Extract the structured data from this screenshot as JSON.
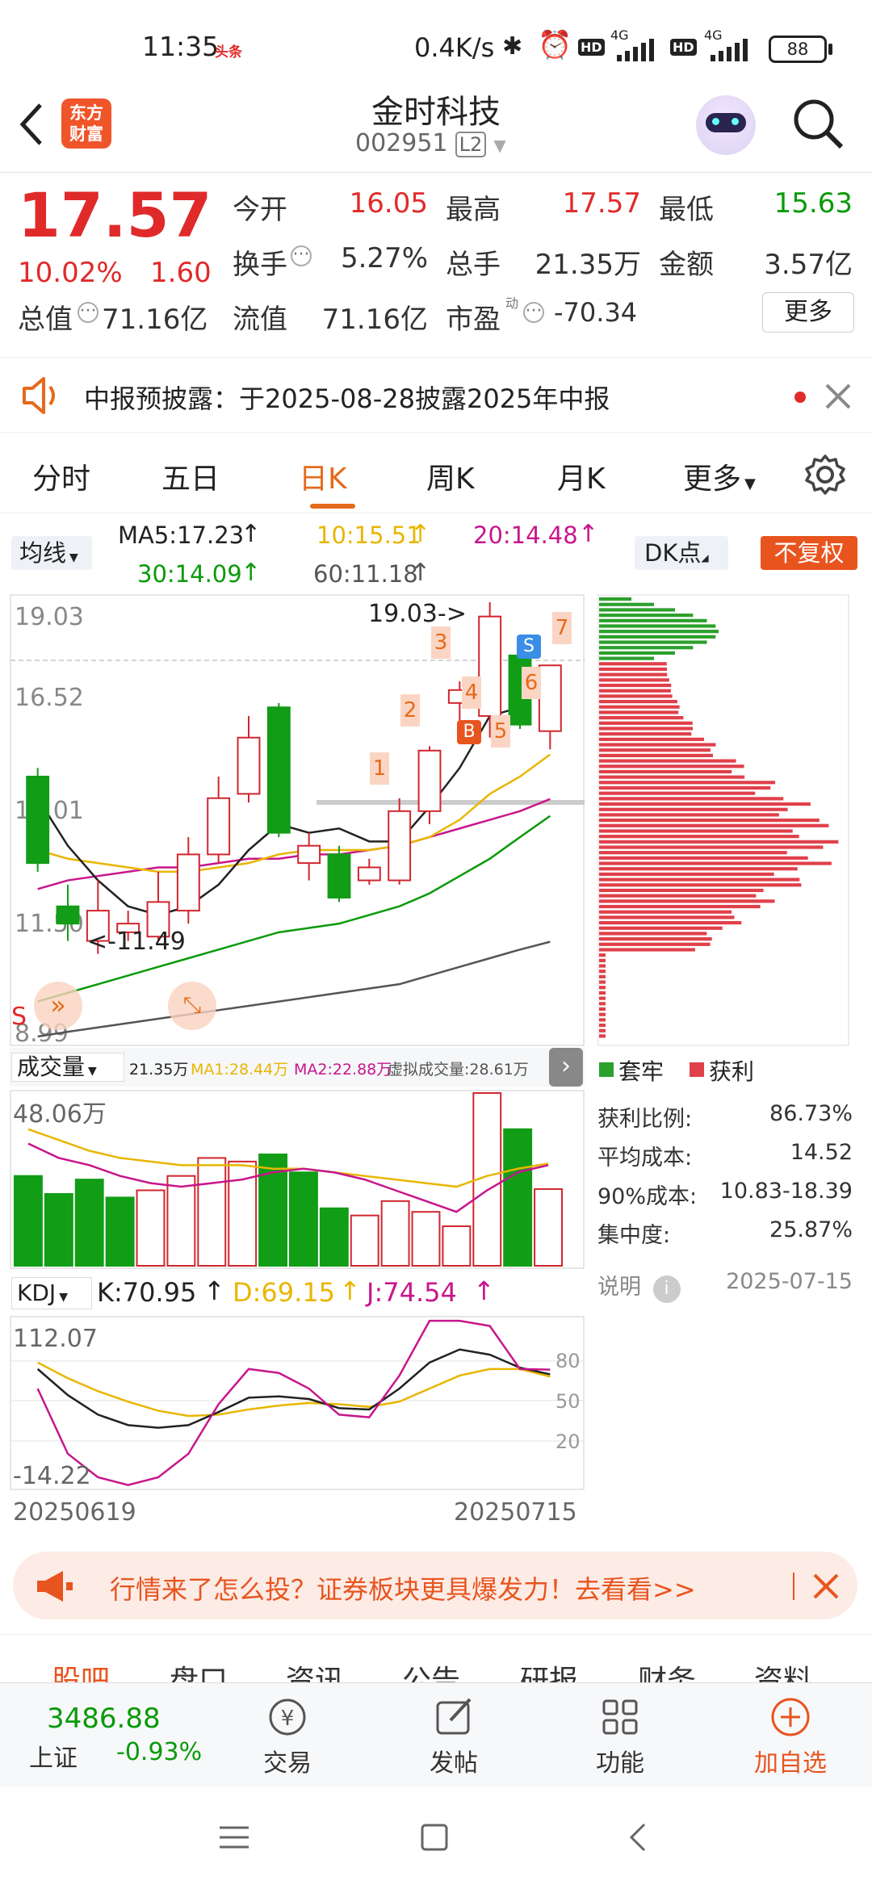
{
  "status_bar": {
    "time": "11:35",
    "news_badge": "头条",
    "speed": "0.4K/s",
    "net1": "4G",
    "net2": "4G",
    "hd": "HD",
    "battery": "88"
  },
  "header": {
    "logo_line1": "东方",
    "logo_line2": "财富",
    "title": "金时科技",
    "code": "002951",
    "level": "L2"
  },
  "quote": {
    "price": "17.57",
    "change_pct": "10.02%",
    "change": "1.60",
    "rows": [
      [
        {
          "label": "今开",
          "value": "16.05",
          "color": "red"
        },
        {
          "label": "最高",
          "value": "17.57",
          "color": "red"
        },
        {
          "label": "最低",
          "value": "15.63",
          "color": "green"
        }
      ],
      [
        {
          "label": "换手",
          "value": "5.27%",
          "color": "dark"
        },
        {
          "label": "总手",
          "value": "21.35万",
          "color": "dark"
        },
        {
          "label": "金额",
          "value": "3.57亿",
          "color": "dark"
        }
      ]
    ],
    "total_cap_label": "总值",
    "total_cap": "71.16亿",
    "float_cap_label": "流值",
    "float_cap": "71.16亿",
    "pe_label": "市盈",
    "pe_sup": "动",
    "pe": "-70.34",
    "more_button": "更多"
  },
  "notice": {
    "text": "中报预披露：于2025-08-28披露2025年中报"
  },
  "tabs": {
    "items": [
      "分时",
      "五日",
      "日K",
      "周K",
      "月K",
      "更多"
    ],
    "active_index": 2
  },
  "ma_legend": {
    "selector": "均线",
    "ma5": "MA5:17.23",
    "ma10": "10:15.51",
    "ma20": "20:14.48",
    "ma30": "30:14.09",
    "ma60": "60:11.18",
    "dk_button": "DK点",
    "fq_button": "不复权"
  },
  "kline": {
    "y_labels": [
      "19.03",
      "16.52",
      "14.01",
      "11.50",
      "8.99"
    ],
    "high_annotation": "19.03->",
    "low_annotation": "<-11.49",
    "markers": [
      "1",
      "2",
      "3",
      "4",
      "5",
      "6",
      "7"
    ],
    "b_marker": "B",
    "s_marker": "S",
    "s_marker_left": "S",
    "chart_data": {
      "type": "candlestick",
      "ylim": [
        8.99,
        19.03
      ],
      "candles": [
        {
          "o": 15.0,
          "c": 13.0,
          "h": 15.2,
          "l": 12.8
        },
        {
          "o": 12.0,
          "c": 11.6,
          "h": 12.5,
          "l": 11.2
        },
        {
          "o": 11.2,
          "c": 11.9,
          "h": 12.6,
          "l": 10.9
        },
        {
          "o": 11.4,
          "c": 11.6,
          "h": 11.9,
          "l": 11.2
        },
        {
          "o": 11.3,
          "c": 12.1,
          "h": 12.8,
          "l": 11.2
        },
        {
          "o": 11.9,
          "c": 13.2,
          "h": 13.6,
          "l": 11.6
        },
        {
          "o": 13.2,
          "c": 14.5,
          "h": 15.0,
          "l": 13.0
        },
        {
          "o": 14.6,
          "c": 15.9,
          "h": 16.4,
          "l": 14.4
        },
        {
          "o": 16.6,
          "c": 13.7,
          "h": 16.7,
          "l": 13.6
        },
        {
          "o": 13.0,
          "c": 13.4,
          "h": 13.7,
          "l": 12.6
        },
        {
          "o": 13.2,
          "c": 12.2,
          "h": 13.4,
          "l": 12.1
        },
        {
          "o": 12.6,
          "c": 12.9,
          "h": 13.1,
          "l": 12.5
        },
        {
          "o": 12.6,
          "c": 14.2,
          "h": 14.5,
          "l": 12.5
        },
        {
          "o": 14.2,
          "c": 15.6,
          "h": 15.7,
          "l": 13.9
        },
        {
          "o": 16.7,
          "c": 17.0,
          "h": 17.2,
          "l": 16.3
        },
        {
          "o": 16.4,
          "c": 18.7,
          "h": 19.03,
          "l": 15.9
        },
        {
          "o": 17.8,
          "c": 16.2,
          "h": 18.0,
          "l": 16.1
        },
        {
          "o": 16.05,
          "c": 17.57,
          "h": 17.57,
          "l": 15.63
        }
      ],
      "ma5": [
        14.5,
        13.4,
        12.6,
        12.0,
        11.8,
        12.0,
        12.5,
        13.3,
        13.9,
        13.7,
        13.8,
        13.5,
        13.5,
        14.3,
        15.2,
        16.4,
        16.6,
        17.23
      ],
      "ma10": [
        13.3,
        13.1,
        13.0,
        12.9,
        12.8,
        12.8,
        12.9,
        13.0,
        13.2,
        13.3,
        13.3,
        13.3,
        13.4,
        13.6,
        14.0,
        14.6,
        15.0,
        15.51
      ],
      "ma20": [
        12.4,
        12.6,
        12.7,
        12.8,
        12.9,
        12.9,
        13.0,
        13.1,
        13.1,
        13.2,
        13.2,
        13.3,
        13.4,
        13.6,
        13.8,
        14.0,
        14.2,
        14.48
      ],
      "ma30": [
        9.8,
        10.0,
        10.2,
        10.4,
        10.6,
        10.8,
        11.0,
        11.2,
        11.4,
        11.5,
        11.6,
        11.8,
        12.0,
        12.3,
        12.7,
        13.1,
        13.6,
        14.09
      ],
      "ma60": [
        8.99,
        9.1,
        9.2,
        9.3,
        9.4,
        9.5,
        9.6,
        9.7,
        9.8,
        9.9,
        10.0,
        10.1,
        10.2,
        10.4,
        10.6,
        10.8,
        11.0,
        11.18
      ]
    }
  },
  "volume": {
    "selector": "成交量",
    "vol": "21.35万",
    "ma1": "MA1:28.44万",
    "ma2": "MA2:22.88万",
    "virtual": "虚拟成交量:28.61万",
    "y_label": "48.06万",
    "chart_data": {
      "type": "bar",
      "ylim": [
        0,
        48.06
      ],
      "values": [
        25,
        20,
        24,
        19,
        21,
        25,
        30,
        29,
        31,
        26,
        16,
        14,
        18,
        15,
        11,
        48.06,
        38,
        21.35
      ],
      "up": [
        false,
        false,
        false,
        false,
        true,
        true,
        true,
        true,
        false,
        false,
        false,
        true,
        true,
        true,
        true,
        true,
        false,
        true
      ],
      "ma1": [
        38,
        35,
        32,
        30,
        29,
        28,
        28,
        28,
        27,
        27,
        26,
        25,
        24,
        23,
        22,
        25,
        27,
        28.44
      ],
      "ma2": [
        34,
        30,
        28,
        25,
        23,
        22,
        23,
        24,
        26,
        27,
        26,
        24,
        21,
        18,
        15,
        21,
        26,
        28.0
      ]
    }
  },
  "kdj": {
    "selector": "KDJ",
    "k": "K:70.95",
    "d": "D:69.15",
    "j": "J:74.54",
    "y_top": "112.07",
    "y_bottom": "-14.22",
    "ref": [
      "80",
      "50",
      "20"
    ],
    "chart_data": {
      "type": "line",
      "ylim": [
        -14.22,
        112.07
      ],
      "k": [
        75,
        55,
        40,
        32,
        30,
        32,
        42,
        53,
        54,
        52,
        45,
        44,
        60,
        80,
        90,
        86,
        76,
        70.95
      ],
      "d": [
        80,
        68,
        58,
        50,
        43,
        39,
        40,
        44,
        47,
        49,
        48,
        46,
        50,
        60,
        70,
        75,
        75,
        69.15
      ],
      "j": [
        60,
        10,
        -8,
        -14,
        -8,
        10,
        48,
        75,
        72,
        60,
        40,
        38,
        70,
        112,
        112,
        108,
        75,
        74.54
      ]
    }
  },
  "date_range": {
    "start": "20250619",
    "end": "20250715"
  },
  "chips": {
    "legend_trapped": "套牢",
    "legend_profit": "获利",
    "stats": [
      {
        "label": "获利比例:",
        "value": "86.73%"
      },
      {
        "label": "平均成本:",
        "value": "14.52"
      },
      {
        "label": "90%成本:",
        "value": "10.83-18.39"
      },
      {
        "label": "集中度:",
        "value": "25.87%"
      }
    ],
    "explain": "说明",
    "date": "2025-07-15",
    "chart_data": {
      "type": "horizontal-bar",
      "ylim": [
        8.99,
        19.03
      ],
      "trapped_rows": 12,
      "profit_rows": 70
    }
  },
  "banner": {
    "text": "行情来了怎么投？证券板块更具爆发力！去看看>>"
  },
  "bottom_tabs": [
    "股吧",
    "盘口",
    "资讯",
    "公告",
    "研报",
    "财务",
    "资料"
  ],
  "toolbar": {
    "index_value": "3486.88",
    "index_name": "上证",
    "index_change": "-0.93%",
    "items": [
      "交易",
      "发帖",
      "功能",
      "加自选"
    ]
  }
}
